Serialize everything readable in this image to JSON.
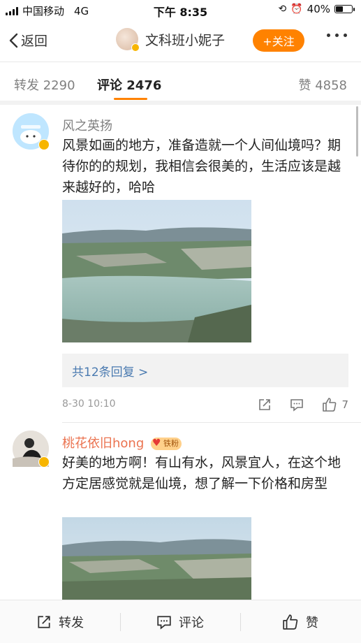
{
  "status_bar": {
    "carrier": "中国移动",
    "network": "4G",
    "time": "下午 8:35",
    "battery": "40%",
    "battery_level": 0.4
  },
  "nav": {
    "back_label": "返回",
    "username": "文科班小妮子",
    "follow_label": "+关注"
  },
  "tabs": [
    {
      "label": "转发 2290"
    },
    {
      "label": "评论 2476"
    },
    {
      "label": "赞 4858"
    }
  ],
  "comments": [
    {
      "username": "风之英扬",
      "text": "风景如画的地方，准备造就一个人间仙境吗？期待你的的规划，我相信会很美的，生活应该是越来越好的，哈哈",
      "replies_label": "共12条回复 >",
      "date": "8-30 10:10",
      "likes": "7"
    },
    {
      "username": "桃花依旧hong",
      "fan_badge": "铁粉",
      "text": "好美的地方啊！有山有水，风景宜人，在这个地方定居感觉就是仙境，想了解一下价格和房型"
    }
  ],
  "bottom_bar": {
    "repost_label": "转发",
    "comment_label": "评论",
    "like_label": "赞"
  }
}
